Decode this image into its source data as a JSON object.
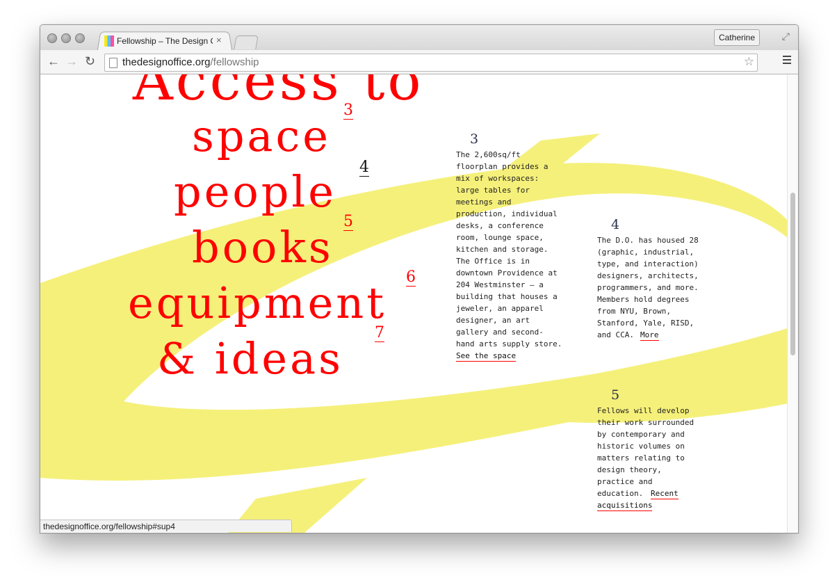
{
  "browser": {
    "tab_title": "Fellowship – The Design O",
    "tab_close": "×",
    "profile_name": "Catherine",
    "url_domain": "thedesignoffice.org",
    "url_path": "/fellowship",
    "status_url": "thedesignoffice.org/fellowship#sup4"
  },
  "hero": {
    "line1": "Access to",
    "line2": "space",
    "line3": "people",
    "line4": "books",
    "line5": "equipment",
    "line6": "& ideas",
    "sup3": "3",
    "sup4": "4",
    "sup5": "5",
    "sup6": "6",
    "sup7": "7"
  },
  "notes": {
    "n3": {
      "num": "3",
      "text": "The 2,600sq/ft\nfloorplan provides a\nmix of workspaces:\nlarge tables for\nmeetings and\nproduction, individual\ndesks, a conference\nroom, lounge space,\nkitchen and storage.\nThe Office is in\ndowntown Providence at\n204 Westminster – a\nbuilding that houses a\njeweler, an apparel\ndesigner, an art\ngallery and second-\nhand arts supply store.",
      "link": "See the space"
    },
    "n4": {
      "num": "4",
      "text": "The D.O. has housed 28\n(graphic, industrial,\ntype, and interaction)\ndesigners, architects,\nprogrammers, and more.\nMembers hold degrees\nfrom NYU, Brown,\nStanford, Yale, RISD,\nand CCA.",
      "link": "More"
    },
    "n5": {
      "num": "5",
      "text": "Fellows will develop\ntheir work surrounded\nby contemporary and\nhistoric volumes on\nmatters relating to\ndesign theory,\npractice and\neducation.",
      "link1": "Recent",
      "link2": "acquisitions"
    }
  },
  "colors": {
    "accent": "#ff0000",
    "highlight": "#f5f07a"
  }
}
